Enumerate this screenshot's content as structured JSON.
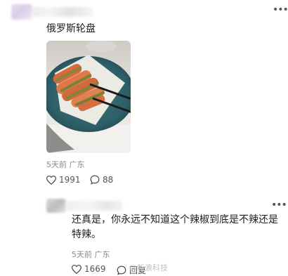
{
  "post": {
    "text": "俄罗斯轮盘",
    "meta": "5天前  广东",
    "likes": "1991",
    "comments": "88",
    "image": {
      "description_icon": "food-photo"
    }
  },
  "reply": {
    "text": "还真是，你永远不知道这个辣椒到底是不辣还是特辣。",
    "meta": "5天前  广东",
    "likes": "1669",
    "action_label": "回复",
    "watermark": "@新浪科技"
  },
  "icons": {
    "like": "heart-icon",
    "comment": "comment-bubble-icon",
    "more": "more-options-icon"
  },
  "colors": {
    "text_primary": "#1e1e1e",
    "text_secondary": "#8a8a8a",
    "plate": "#2e5f68"
  }
}
